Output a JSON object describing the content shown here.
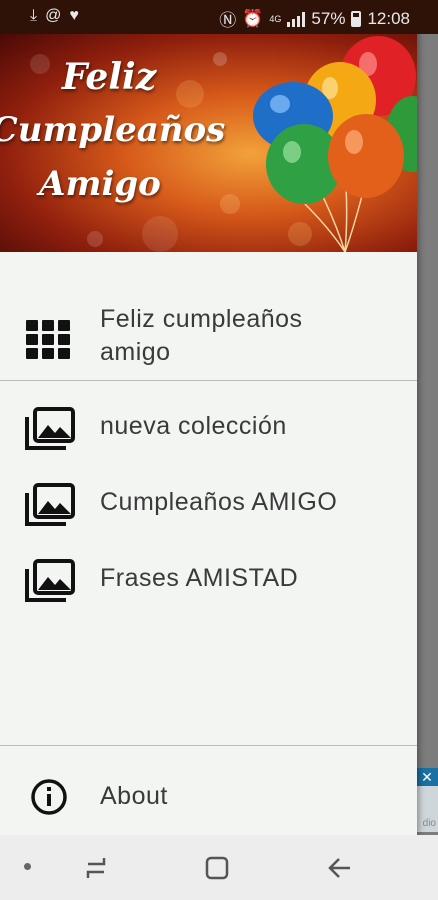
{
  "status_bar": {
    "notification_icons": [
      "download-icon",
      "at-icon",
      "heart-icon"
    ],
    "battery_percent": "57%",
    "time": "12:08",
    "network_label": "4G"
  },
  "drawer": {
    "header": {
      "title_line1": "Feliz",
      "title_line2": "Cumpleaños",
      "title_line3": "Amigo"
    },
    "menu": [
      {
        "label": "Feliz cumpleaños amigo",
        "icon": "grid-icon"
      },
      {
        "label": "nueva colección",
        "icon": "photo-library-icon"
      },
      {
        "label": "Cumpleaños AMIGO",
        "icon": "photo-library-icon"
      },
      {
        "label": "Frases AMISTAD",
        "icon": "photo-library-icon"
      }
    ],
    "footer": {
      "label": "About",
      "icon": "info-icon"
    }
  },
  "background": {
    "ad_fragment": "dio"
  },
  "nav_bar": [
    "recent-apps-icon",
    "home-icon",
    "back-icon"
  ],
  "colors": {
    "drawer_bg": "#f3f5f3",
    "text": "#3a3a3a",
    "header_dark": "#4a0906",
    "header_light": "#f2a23a"
  }
}
